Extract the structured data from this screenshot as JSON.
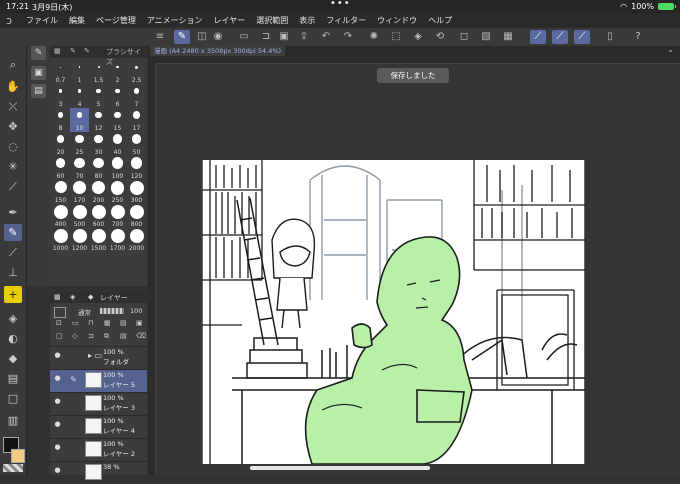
{
  "status": {
    "time": "17:21",
    "date": "3月9日(木)",
    "dots": "•••",
    "battery": "100%"
  },
  "menu": [
    "ファイル",
    "編集",
    "ページ管理",
    "アニメーション",
    "レイヤー",
    "選択範囲",
    "表示",
    "フィルター",
    "ウィンドウ",
    "ヘルプ"
  ],
  "brush": {
    "tab_label": "ブラシサイズ",
    "sizes": [
      "0.7",
      "1",
      "1.5",
      "2",
      "2.5",
      "3",
      "4",
      "5",
      "6",
      "7",
      "8",
      "10",
      "12",
      "15",
      "17",
      "20",
      "25",
      "30",
      "40",
      "50",
      "60",
      "70",
      "80",
      "100",
      "120",
      "150",
      "170",
      "200",
      "250",
      "300",
      "400",
      "500",
      "600",
      "700",
      "800",
      "1000",
      "1200",
      "1500",
      "1700",
      "2000"
    ],
    "selected": "10"
  },
  "document": {
    "tab": "漫画 (A4 2480 x 3508px 300dpi 54.4%)"
  },
  "toast": "保存しました",
  "layers": {
    "header": "レイヤー",
    "blend": "通常",
    "opacity": "100",
    "rows": [
      {
        "pct": "100 %",
        "name": "フォルダ"
      },
      {
        "pct": "100 %",
        "name": "レイヤー 5"
      },
      {
        "pct": "100 %",
        "name": "レイヤー 3"
      },
      {
        "pct": "100 %",
        "name": "レイヤー 4"
      },
      {
        "pct": "100 %",
        "name": "レイヤー 2"
      },
      {
        "pct": "38 %",
        "name": ""
      }
    ]
  },
  "colors": {
    "main": "#141414",
    "sub": "#f2ce7a",
    "accent": "#5a6aa0",
    "figure_fill": "#b8f0a8"
  }
}
